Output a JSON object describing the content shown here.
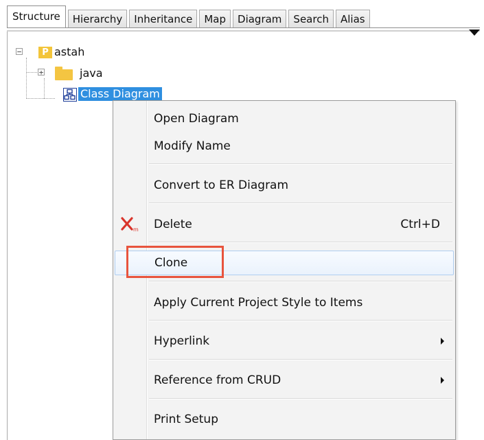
{
  "tabs": [
    {
      "label": "Structure",
      "active": true
    },
    {
      "label": "Hierarchy",
      "active": false
    },
    {
      "label": "Inheritance",
      "active": false
    },
    {
      "label": "Map",
      "active": false
    },
    {
      "label": "Diagram",
      "active": false
    },
    {
      "label": "Search",
      "active": false
    },
    {
      "label": "Alias",
      "active": false
    }
  ],
  "tree": {
    "project": {
      "label": "astah",
      "icon": "project-icon",
      "icon_letter": "P",
      "expanded": true
    },
    "folder": {
      "label": "java",
      "icon": "folder-icon",
      "expanded": false
    },
    "diagram": {
      "label": "Class Diagram",
      "icon": "class-diagram-icon",
      "selected": true
    }
  },
  "context_menu": {
    "items": [
      {
        "label": "Open Diagram"
      },
      {
        "label": "Modify Name"
      },
      {
        "label": "Convert to ER Diagram"
      },
      {
        "label": "Delete",
        "shortcut": "Ctrl+D",
        "icon": "delete-icon"
      },
      {
        "label": "Clone",
        "highlighted": true
      },
      {
        "label": "Apply Current Project Style to Items"
      },
      {
        "label": "Hyperlink",
        "submenu": true
      },
      {
        "label": "Reference from CRUD",
        "submenu": true
      },
      {
        "label": "Print Setup"
      }
    ]
  },
  "colors": {
    "selection": "#2f8fe0",
    "highlight_box": "#e8543d",
    "delete_icon": "#d9342b",
    "folder": "#f4c542",
    "project_icon": "#f3c53a"
  }
}
